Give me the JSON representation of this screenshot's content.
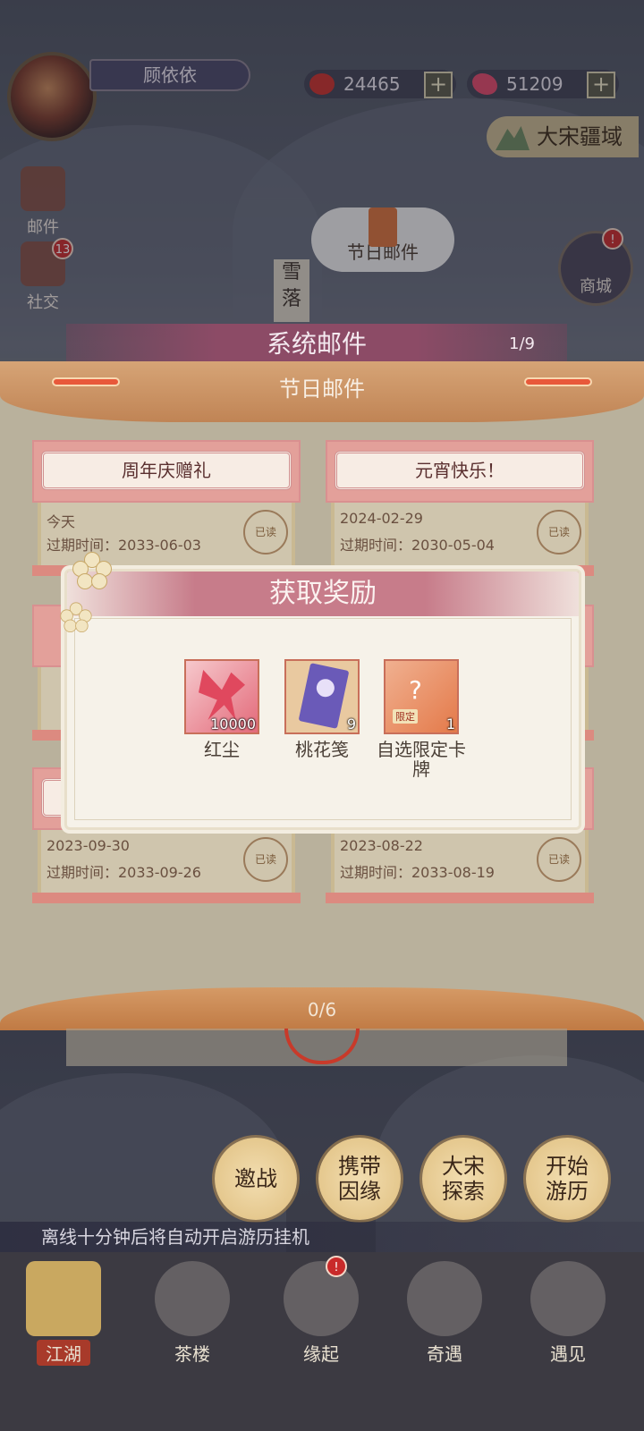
{
  "player": {
    "name": "顾依依"
  },
  "currency": {
    "red": {
      "icon": "red-bean-icon",
      "value": "24465",
      "add_label": "+"
    },
    "butterfly": {
      "icon": "butterfly-icon",
      "value": "51209",
      "add_label": "+"
    }
  },
  "region": {
    "label": "大宋疆域"
  },
  "side": {
    "mail": {
      "label": "邮件"
    },
    "social": {
      "label": "社交",
      "badge": "13"
    },
    "festival_mail": {
      "label": "节日邮件"
    },
    "snow_sign": "雪落",
    "shop": {
      "label": "商城"
    }
  },
  "mail_panel": {
    "title": "系统邮件",
    "page": "1/9",
    "tab_title": "节日邮件",
    "read_label": "已读",
    "cards": [
      {
        "title": "周年庆赠礼",
        "date": "今天",
        "expiry": "过期时间：2033-06-03"
      },
      {
        "title": "元宵快乐！",
        "date": "2024-02-29",
        "expiry": "过期时间：2030-05-04"
      },
      {
        "title": "",
        "date": "2023-09-30",
        "expiry": "过期时间：2033-09-26"
      },
      {
        "title": "",
        "date": "2023-08-22",
        "expiry": "过期时间：2033-08-19"
      }
    ],
    "progress": "0/6"
  },
  "reward_dialog": {
    "title": "获取奖励",
    "items": [
      {
        "name": "红尘",
        "qty": "10000",
        "icon": "red-butterfly-icon"
      },
      {
        "name": "桃花笺",
        "qty": "9",
        "icon": "peach-letter-icon"
      },
      {
        "name": "自选限定卡牌",
        "qty": "1",
        "icon": "mystery-card-icon",
        "tag": "限定"
      }
    ]
  },
  "actions": {
    "challenge": "邀战",
    "carry_fate": "携带因缘",
    "explore": "大宋探索",
    "travel": "开始游历"
  },
  "ticker": "离线十分钟后将自动开启游历挂机",
  "nav": [
    {
      "label": "江湖",
      "active": true
    },
    {
      "label": "茶楼",
      "active": false
    },
    {
      "label": "缘起",
      "active": false
    },
    {
      "label": "奇遇",
      "active": false
    },
    {
      "label": "遇见",
      "active": false
    }
  ],
  "colors": {
    "dialog_title_bg": "#c77c8a",
    "banner": "#c98c5a",
    "card_top": "#e3a09a",
    "accent_red": "#c92a2a"
  }
}
